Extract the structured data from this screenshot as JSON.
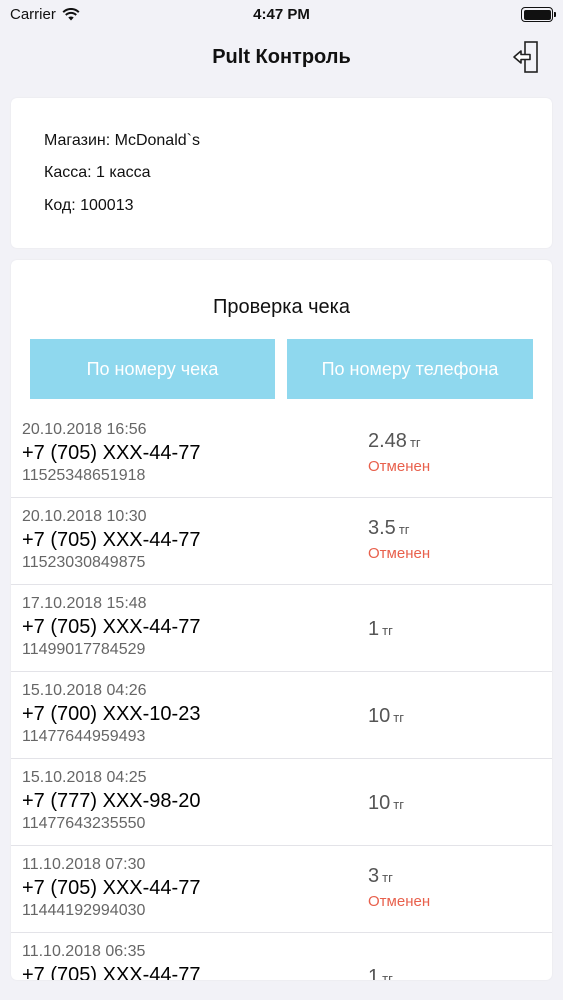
{
  "status_bar": {
    "carrier": "Carrier",
    "time": "4:47 PM"
  },
  "nav": {
    "title": "Pult Контроль",
    "logout_icon": "logout-icon"
  },
  "store": {
    "shop": "Магазин: McDonald`s",
    "register": "Касса: 1 касса",
    "code": "Код: 100013"
  },
  "check": {
    "title": "Проверка чека",
    "by_receipt": "По номеру чека",
    "by_phone": "По номеру телефона"
  },
  "rows": [
    {
      "date": "20.10.2018 16:56",
      "phone": "+7 (705) XXX-44-77",
      "code": "11525348651918",
      "amount": "2.48",
      "currency": "тг",
      "status": "Отменен"
    },
    {
      "date": "20.10.2018 10:30",
      "phone": "+7 (705) XXX-44-77",
      "code": "11523030849875",
      "amount": "3.5",
      "currency": "тг",
      "status": "Отменен"
    },
    {
      "date": "17.10.2018 15:48",
      "phone": "+7 (705) XXX-44-77",
      "code": "11499017784529",
      "amount": "1",
      "currency": "тг",
      "status": ""
    },
    {
      "date": "15.10.2018 04:26",
      "phone": "+7 (700) XXX-10-23",
      "code": "11477644959493",
      "amount": "10",
      "currency": "тг",
      "status": ""
    },
    {
      "date": "15.10.2018 04:25",
      "phone": "+7 (777) XXX-98-20",
      "code": "11477643235550",
      "amount": "10",
      "currency": "тг",
      "status": ""
    },
    {
      "date": "11.10.2018 07:30",
      "phone": "+7 (705) XXX-44-77",
      "code": "11444192994030",
      "amount": "3",
      "currency": "тг",
      "status": "Отменен"
    },
    {
      "date": "11.10.2018 06:35",
      "phone": "+7 (705) XXX-44-77",
      "code": "",
      "amount": "1",
      "currency": "тг",
      "status": ""
    }
  ]
}
